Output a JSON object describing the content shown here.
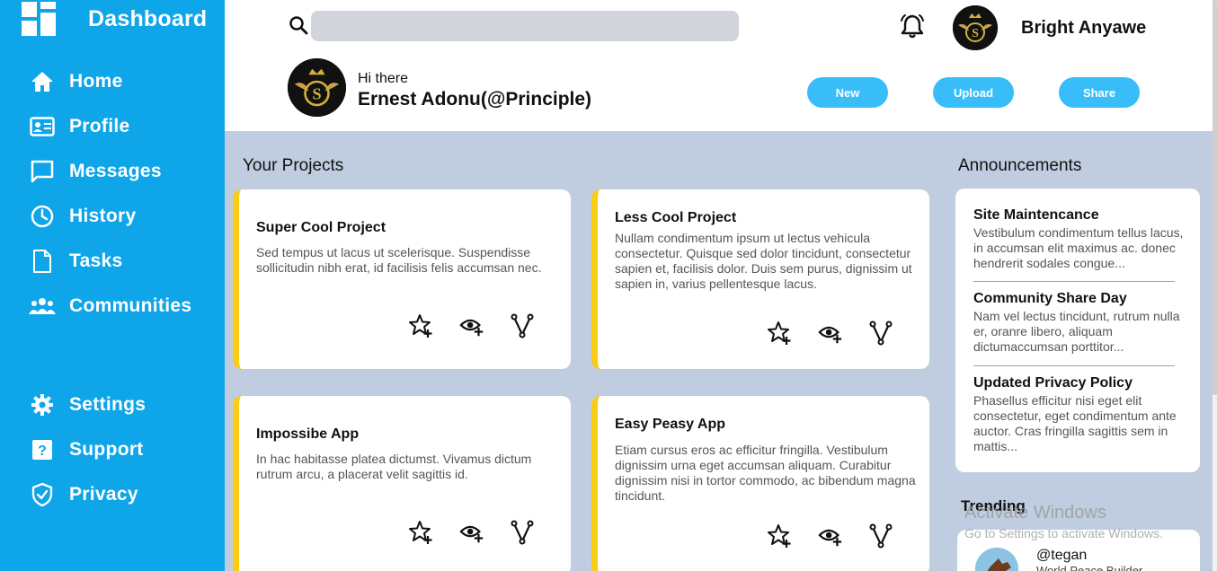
{
  "sidebar": {
    "brand_title": "Dashboard",
    "nav": [
      {
        "label": "Home",
        "icon": "home-icon"
      },
      {
        "label": "Profile",
        "icon": "id-card-icon"
      },
      {
        "label": "Messages",
        "icon": "chat-icon"
      },
      {
        "label": "History",
        "icon": "clock-icon"
      },
      {
        "label": "Tasks",
        "icon": "document-icon"
      },
      {
        "label": "Communities",
        "icon": "group-icon"
      }
    ],
    "bottom_nav": [
      {
        "label": "Settings",
        "icon": "gear-icon"
      },
      {
        "label": "Support",
        "icon": "help-icon"
      },
      {
        "label": "Privacy",
        "icon": "shield-icon"
      }
    ]
  },
  "header": {
    "search_placeholder": "",
    "user_name": "Bright Anyawe",
    "greeting": "Hi there",
    "display_name": "Ernest Adonu(@Principle)",
    "buttons": {
      "new": "New",
      "upload": "Upload",
      "share": "Share"
    }
  },
  "projects": {
    "title": "Your Projects",
    "items": [
      {
        "title": "Super Cool Project",
        "description": "Sed tempus ut lacus ut scelerisque. Suspendisse sollicitudin nibh erat, id facilisis felis accumsan nec."
      },
      {
        "title": "Less Cool Project",
        "description": "Nullam condimentum ipsum ut lectus vehicula consectetur. Quisque sed dolor tincidunt, consectetur sapien et, facilisis dolor. Duis sem purus, dignissim ut sapien in, varius pellentesque lacus."
      },
      {
        "title": "Impossibe App",
        "description": "In hac habitasse platea dictumst. Vivamus dictum rutrum arcu, a placerat velit sagittis id."
      },
      {
        "title": "Easy Peasy App",
        "description": "Etiam cursus eros ac efficitur fringilla. Vestibulum dignissim urna eget accumsan aliquam. Curabitur dignissim nisi in tortor commodo, ac bibendum magna tincidunt."
      }
    ]
  },
  "announcements": {
    "title": "Announcements",
    "items": [
      {
        "title": "Site Maintencance",
        "body": "Vestibulum condimentum tellus lacus, in accumsan elit maximus ac. donec hendrerit sodales congue..."
      },
      {
        "title": "Community Share Day",
        "body": "Nam vel lectus tincidunt, rutrum nulla er, oranre libero, aliquam dictumaccumsan porttitor..."
      },
      {
        "title": "Updated Privacy Policy",
        "body": "Phasellus efficitur nisi eget elit consectetur, eget condimentum ante auctor. Cras fringilla sagittis sem in mattis..."
      }
    ]
  },
  "trending": {
    "title": "Trending",
    "items": [
      {
        "handle": "@tegan",
        "subtitle": "World Peace Builder"
      }
    ]
  },
  "watermark": {
    "title": "Activate Windows",
    "subtitle": "Go to Settings to activate Windows."
  },
  "colors": {
    "sidebar": "#0ea5e9",
    "accent_button": "#38bdf8",
    "card_stripe": "#facc15",
    "main_bg": "#c0cde0"
  }
}
